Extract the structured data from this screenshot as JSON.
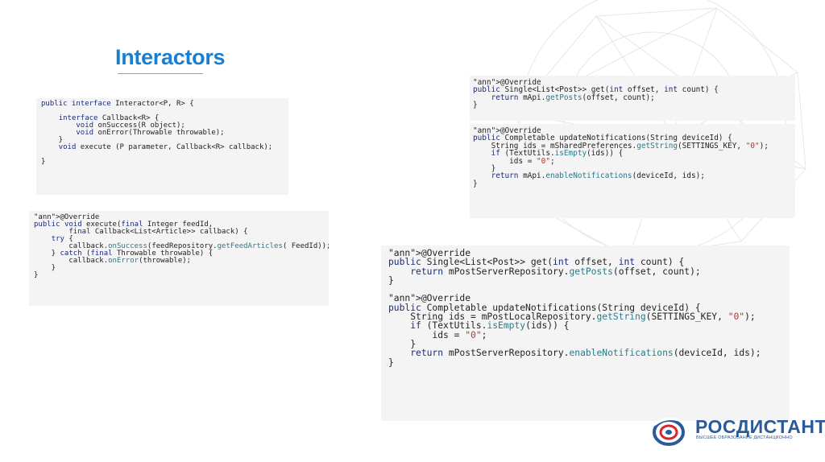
{
  "slide": {
    "title": "Interactors"
  },
  "code_blocks": {
    "interactor_interface": [
      "public interface Interactor<P, R> {",
      "",
      "    interface Callback<R> {",
      "        void onSuccess(R object);",
      "        void onError(Throwable throwable);",
      "    }",
      "    void execute (P parameter, Callback<R> callback);",
      "",
      "}"
    ],
    "execute_impl": [
      "@Override",
      "public void execute(final Integer feedId,",
      "        final Callback<List<Article>> callback) {",
      "    try {",
      "        callback.onSuccess(feedRepository.getFeedArticles( FeedId));",
      "    } catch (final Throwable throwable) {",
      "        callback.onError(throwable);",
      "    }",
      "}"
    ],
    "get_posts_small": [
      "@Override",
      "public Single<List<Post>> get(int offset, int count) {",
      "    return mApi.getPosts(offset, count);",
      "}"
    ],
    "update_notifications_small": [
      "@Override",
      "public Completable updateNotifications(String deviceId) {",
      "    String ids = mSharedPreferences.getString(SETTINGS_KEY, \"0\");",
      "    if (TextUtils.isEmpty(ids)) {",
      "        ids = \"0\";",
      "    }",
      "    return mApi.enableNotifications(deviceId, ids);",
      "}"
    ],
    "repository_large": [
      "@Override",
      "public Single<List<Post>> get(int offset, int count) {",
      "    return mPostServerRepository.getPosts(offset, count);",
      "}",
      "",
      "@Override",
      "public Completable updateNotifications(String deviceId) {",
      "    String ids = mPostLocalRepository.getString(SETTINGS_KEY, \"0\");",
      "    if (TextUtils.isEmpty(ids)) {",
      "        ids = \"0\";",
      "    }",
      "    return mPostServerRepository.enableNotifications(deviceId, ids);",
      "}"
    ]
  },
  "logo": {
    "name": "РОСДИСТАНТ",
    "tagline": "ВЫСШЕЕ ОБРАЗОВАНИЕ ДИСТАНЦИОННО"
  },
  "colors": {
    "title": "#1a7fd0",
    "code_background": "#f4f4f4",
    "keyword": "#1c2a7a",
    "annotation": "#8a5b2e",
    "method_call": "#2a7a8a",
    "string": "#b03a2e",
    "logo": "#2a5a9a"
  }
}
